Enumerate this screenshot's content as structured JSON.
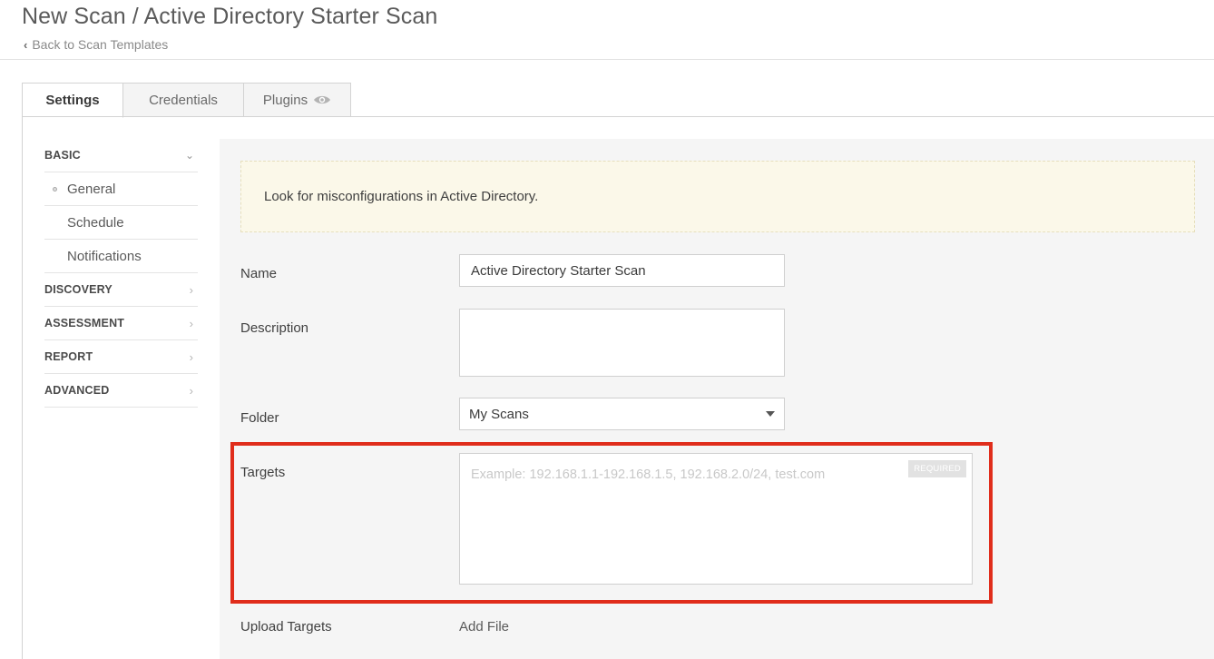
{
  "header": {
    "title": "New Scan / Active Directory Starter Scan",
    "back_link": "Back to Scan Templates"
  },
  "tabs": [
    {
      "label": "Settings",
      "active": true
    },
    {
      "label": "Credentials",
      "active": false
    },
    {
      "label": "Plugins",
      "active": false,
      "icon": "eye-icon"
    }
  ],
  "sidebar": {
    "basic": "BASIC",
    "items": [
      {
        "label": "General",
        "selected": true
      },
      {
        "label": "Schedule"
      },
      {
        "label": "Notifications"
      }
    ],
    "sections": [
      "DISCOVERY",
      "ASSESSMENT",
      "REPORT",
      "ADVANCED"
    ]
  },
  "info": {
    "message": "Look for misconfigurations in Active Directory."
  },
  "form": {
    "name_label": "Name",
    "name_value": "Active Directory Starter Scan",
    "description_label": "Description",
    "description_value": "",
    "folder_label": "Folder",
    "folder_value": "My Scans",
    "targets_label": "Targets",
    "targets_placeholder": "Example: 192.168.1.1-192.168.1.5, 192.168.2.0/24, test.com",
    "targets_required": "REQUIRED",
    "upload_label": "Upload Targets",
    "add_file": "Add File"
  },
  "colors": {
    "highlight": "#e02d1b",
    "info_bg": "#fbf8e9",
    "content_bg": "#f5f5f5"
  }
}
